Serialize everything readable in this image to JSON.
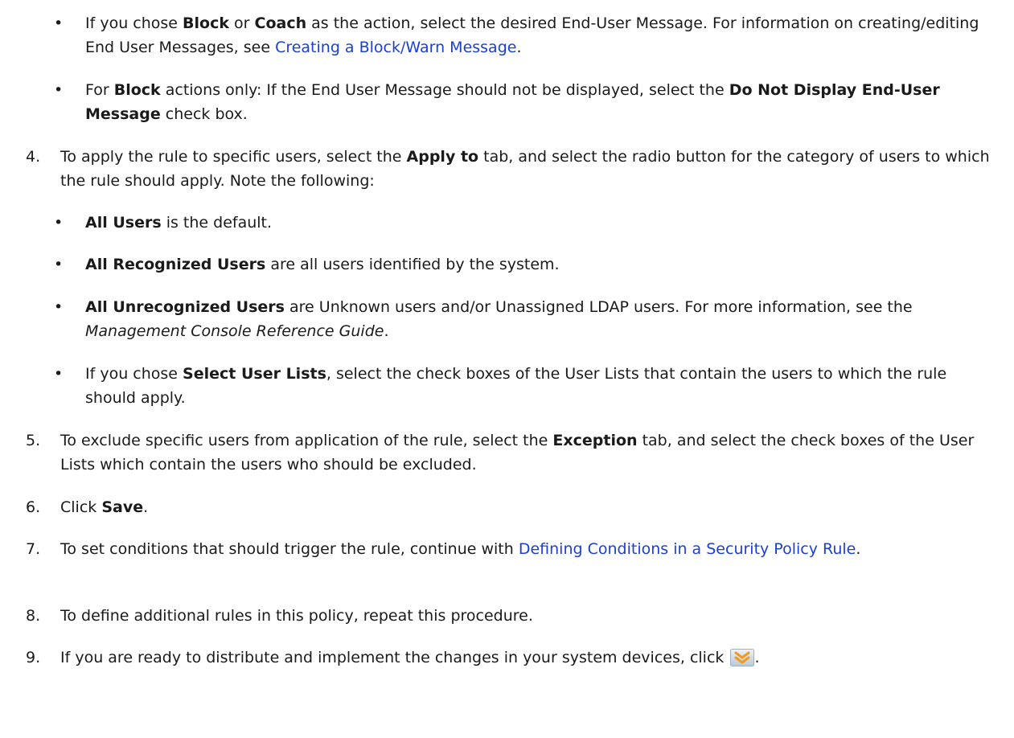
{
  "steps": {
    "s3": {
      "bullet_block_message": {
        "t1": "If you chose ",
        "b1": "Block",
        "t2": " or ",
        "b2": "Coach",
        "t3": " as the action, select the desired End-User Message. For information on creating/editing End User Messages, see ",
        "link": "Creating a Block/Warn Message",
        "t4": "."
      },
      "bullet_do_not_display": {
        "t1": "For ",
        "b1": "Block",
        "t2": " actions only: If the End User Message should not be displayed, select the ",
        "b2": "Do Not Display End-User Message",
        "t3": " check box."
      }
    },
    "s4": {
      "number": "4.",
      "t1": "To apply the rule to specific users, select the ",
      "b1": "Apply to",
      "t2": " tab, and select the radio button for the category of users to which the rule should apply. Note the following:",
      "bullets": {
        "all_users": {
          "b": "All Users",
          "t": " is the default."
        },
        "all_recognized": {
          "b": "All Recognized Users",
          "t": " are all users identified by the system."
        },
        "all_unrecognized": {
          "b": "All Unrecognized Users",
          "t1": " are Unknown users and/or Unassigned LDAP users. For more information, see the ",
          "i": "Management Console Reference Guide",
          "t2": "."
        },
        "select_user_lists": {
          "t1": "If you chose ",
          "b": "Select User Lists",
          "t2": ", select the check boxes of the User Lists that contain the users to which the rule should apply."
        }
      }
    },
    "s5": {
      "number": "5.",
      "t1": "To exclude specific users from application of the rule, select the ",
      "b1": "Exception",
      "t2": " tab, and select the check boxes of the User Lists which contain the users who should be excluded."
    },
    "s6": {
      "number": "6.",
      "t1": "Click ",
      "b1": "Save",
      "t2": "."
    },
    "s7": {
      "number": "7.",
      "t1": "To set conditions that should trigger the rule, continue with ",
      "link": "Defining Conditions in a Security Policy Rule",
      "t2": "."
    },
    "s8": {
      "number": "8.",
      "t1": "To define additional rules in this policy, repeat this procedure."
    },
    "s9": {
      "number": "9.",
      "t1": "If you are ready to distribute and implement the changes in your system devices, click ",
      "icon": "deploy-changes-icon",
      "t2": "."
    }
  },
  "colors": {
    "link": "#1a3fd6",
    "text": "#1a1a1a",
    "icon_chevron": "#f29a1d"
  },
  "bullet_char": "•"
}
